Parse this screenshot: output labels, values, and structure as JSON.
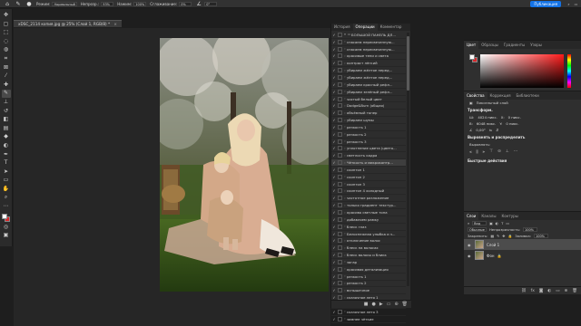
{
  "options_bar": {
    "mode_label": "Режим:",
    "mode_value": "Нормальный",
    "opacity_label": "Непрозр.:",
    "opacity_value": "93%",
    "flow_label": "Нажим:",
    "flow_value": "100%",
    "smoothing_label": "Сглаживание:",
    "smoothing_value": "0%",
    "angle_value": "0°",
    "share_label": "Публикация"
  },
  "document": {
    "tab_title": "xDSC_2114 копия.jpg @ 25% (Слой 1, RGB/8) *",
    "close_symbol": "×"
  },
  "colors": {
    "foreground": "#ffffff",
    "background": "#d8262a",
    "accent": "#1473e6",
    "panel_bg": "#2d2d2d"
  },
  "operations_panel": {
    "tabs": [
      "История",
      "Операции",
      "Комментар"
    ],
    "active_tab": 1,
    "items": [
      "БОЛЬШОЙ ПАНЕЛЬ ДЛ...",
      "спасаем пересвеченную...",
      "спасаем пересвеченную...",
      "красивые тени и света",
      "контраст лёгкий",
      "убираем жёлтое перед...",
      "убираем жёлтое перед...",
      "убираем красный рефл...",
      "убираем зелёный рефл...",
      "чистый белый цвет",
      "Dodge&Burn (общая)",
      "объёмный тонер",
      "убираем шумы",
      "резкость 1",
      "резкость 2",
      "резкость 3",
      "уплотнение цвета (цвето...",
      "светлость кадра",
      "Чёткость и микроконтр...",
      "скинтон 1",
      "скинтон 2",
      "скинтон 3",
      "скинтон 4 холодный",
      "частотное разложение",
      "только градиент текстур...",
      "красиво светлые тона",
      "добавляем рамку",
      "блеск глаз",
      "Белоснежная улыбка и з...",
      "отключение волос",
      "блеск на волосах",
      "блеск волосы и бликк",
      "загар",
      "красивая детализация",
      "резкость 1",
      "резкость 2",
      "вспышечное",
      "сказочное лето 1",
      "сказочное лето 2",
      "сказочное лето 3",
      "зимнее чёткие"
    ],
    "highlighted_index": 18
  },
  "color_panel": {
    "tabs": [
      "Цвет",
      "Образцы",
      "Градиенты",
      "Узоры"
    ],
    "active_tab": 0
  },
  "properties_panel": {
    "tabs": [
      "Свойства",
      "Коррекция",
      "Библиотеки"
    ],
    "active_tab": 0,
    "layer_type": "Пиксельный слой",
    "transform_title": "Трансформ.",
    "w_label": "Ш:",
    "w_value": "4024 пикс.",
    "x_label": "X:",
    "x_value": "0 пикс.",
    "h_label": "В:",
    "h_value": "6048 пикс.",
    "y_label": "Y:",
    "y_value": "0 пикс.",
    "angle_value": "0,00°",
    "align_title": "Выровнять и распределить",
    "align_sub": "Выровнять:",
    "quick_title": "Быстрые действия"
  },
  "layers_panel": {
    "tabs": [
      "Слои",
      "Каналы",
      "Контуры"
    ],
    "active_tab": 0,
    "search_label": "Вид",
    "blend_mode": "Обычные",
    "opacity_label": "Непрозрачность:",
    "opacity_value": "100%",
    "lock_label": "Закрепить:",
    "fill_label": "Заливка:",
    "fill_value": "100%",
    "layers": [
      {
        "name": "Слой 1",
        "active": true
      },
      {
        "name": "Фон",
        "active": false
      }
    ]
  }
}
